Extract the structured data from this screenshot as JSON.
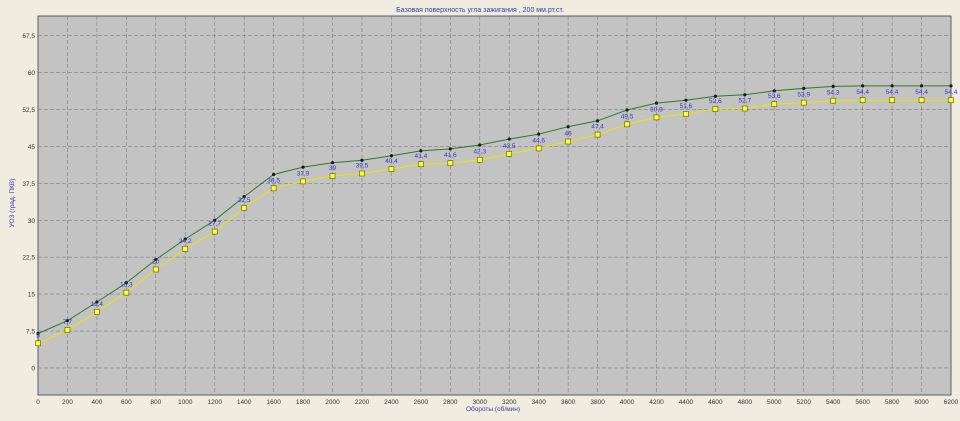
{
  "chart_data": {
    "type": "line",
    "title": "Базовая поверхность угла зажигания , 200 мм.рт.ст.",
    "xlabel": "Обороты (об/мин)",
    "ylabel": "УОЗ (град. ПКВ)",
    "x": [
      0,
      200,
      400,
      600,
      800,
      1000,
      1200,
      1400,
      1600,
      1800,
      2000,
      2200,
      2400,
      2600,
      2800,
      3000,
      3200,
      3400,
      3600,
      3800,
      4000,
      4200,
      4400,
      4600,
      4800,
      5000,
      5200,
      5400,
      5600,
      5800,
      6000,
      6200
    ],
    "x_ticks": [
      "0",
      "200",
      "400",
      "600",
      "800",
      "1000",
      "1200",
      "1400",
      "1600",
      "1800",
      "2000",
      "2200",
      "2400",
      "2600",
      "2800",
      "3000",
      "3200",
      "3400",
      "3600",
      "3800",
      "4000",
      "4200",
      "4400",
      "4600",
      "4800",
      "5000",
      "5200",
      "5400",
      "5600",
      "5800",
      "6000",
      "6200"
    ],
    "y_ticks": [
      "0",
      "7,5",
      "15",
      "22,5",
      "30",
      "37,5",
      "45",
      "52,5",
      "60",
      "67,5"
    ],
    "y_tick_values": [
      0,
      7.5,
      15,
      22.5,
      30,
      37.5,
      45,
      52.5,
      60,
      67.5
    ],
    "xlim": [
      0,
      6200
    ],
    "ylim": [
      -5.5,
      71.5
    ],
    "grid": true,
    "series": [
      {
        "values": [
          7,
          9.6,
          13.4,
          17.3,
          22,
          26.2,
          30,
          34.8,
          39.3,
          40.8,
          41.7,
          42.2,
          43.1,
          44.1,
          44.5,
          45.3,
          46.5,
          47.5,
          49,
          50.2,
          52.4,
          53.8,
          54.4,
          55.2,
          55.5,
          56.3,
          56.8,
          57.2,
          57.3,
          57.3,
          57.3,
          57.3
        ],
        "color": "#2d7a2d",
        "marker_color": "#1a1a1a"
      },
      {
        "values": [
          5,
          7.7,
          11.4,
          15.3,
          20,
          24.2,
          27.7,
          32.5,
          36.5,
          37.9,
          39,
          39.5,
          40.4,
          41.4,
          41.6,
          42.3,
          43.5,
          44.6,
          46,
          47.4,
          49.5,
          50.9,
          51.6,
          52.6,
          52.7,
          53.6,
          53.9,
          54.3,
          54.4,
          54.4,
          54.4,
          54.4
        ],
        "labels": [
          "5",
          "7,7",
          "11,4",
          "15,3",
          "20",
          "24,2",
          "27,7",
          "32,5",
          "36,5",
          "37,9",
          "39",
          "39,5",
          "40,4",
          "41,4",
          "41,6",
          "42,3",
          "43,5",
          "44,6",
          "46",
          "47,4",
          "49,5",
          "50,9",
          "51,6",
          "52,6",
          "52,7",
          "53,6",
          "53,9",
          "54,3",
          "54,4",
          "54,4",
          "54,4",
          "54,4"
        ],
        "color": "#e8e800",
        "marker_color": "#ffff33"
      }
    ],
    "colors": {
      "plot_bg": "#c3c3c3",
      "outer_bg": "#f0ecdf",
      "grid": "#808080",
      "text": "#333333",
      "title": "#3a3aa8",
      "data_label": "#3333cc"
    }
  }
}
